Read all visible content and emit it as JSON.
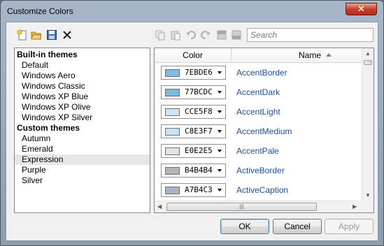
{
  "window": {
    "title": "Customize Colors",
    "close_label": "✕"
  },
  "toolbar": {
    "search_placeholder": "Search"
  },
  "themes": {
    "builtin_header": "Built-in themes",
    "builtin": [
      "Default",
      "Windows Aero",
      "Windows Classic",
      "Windows XP Blue",
      "Windows XP Olive",
      "Windows XP Silver"
    ],
    "custom_header": "Custom themes",
    "custom": [
      "Autumn",
      "Emerald",
      "Expression",
      "Purple",
      "Silver"
    ],
    "selected": "Expression"
  },
  "grid": {
    "col_color": "Color",
    "col_name": "Name",
    "rows": [
      {
        "hex": "7EBDE6",
        "name": "AccentBorder",
        "color": "#7ebde6"
      },
      {
        "hex": "77BCDC",
        "name": "AccentDark",
        "color": "#77bcdc"
      },
      {
        "hex": "CCE5F8",
        "name": "AccentLight",
        "color": "#cce5f8"
      },
      {
        "hex": "C8E3F7",
        "name": "AccentMedium",
        "color": "#c8e3f7"
      },
      {
        "hex": "E0E2E5",
        "name": "AccentPale",
        "color": "#e0e2e5"
      },
      {
        "hex": "B4B4B4",
        "name": "ActiveBorder",
        "color": "#b4b4b4"
      },
      {
        "hex": "A7B4C3",
        "name": "ActiveCaption",
        "color": "#a7b4c3"
      }
    ],
    "hscroll_grip": "|||"
  },
  "buttons": {
    "ok": "OK",
    "cancel": "Cancel",
    "apply": "Apply"
  }
}
